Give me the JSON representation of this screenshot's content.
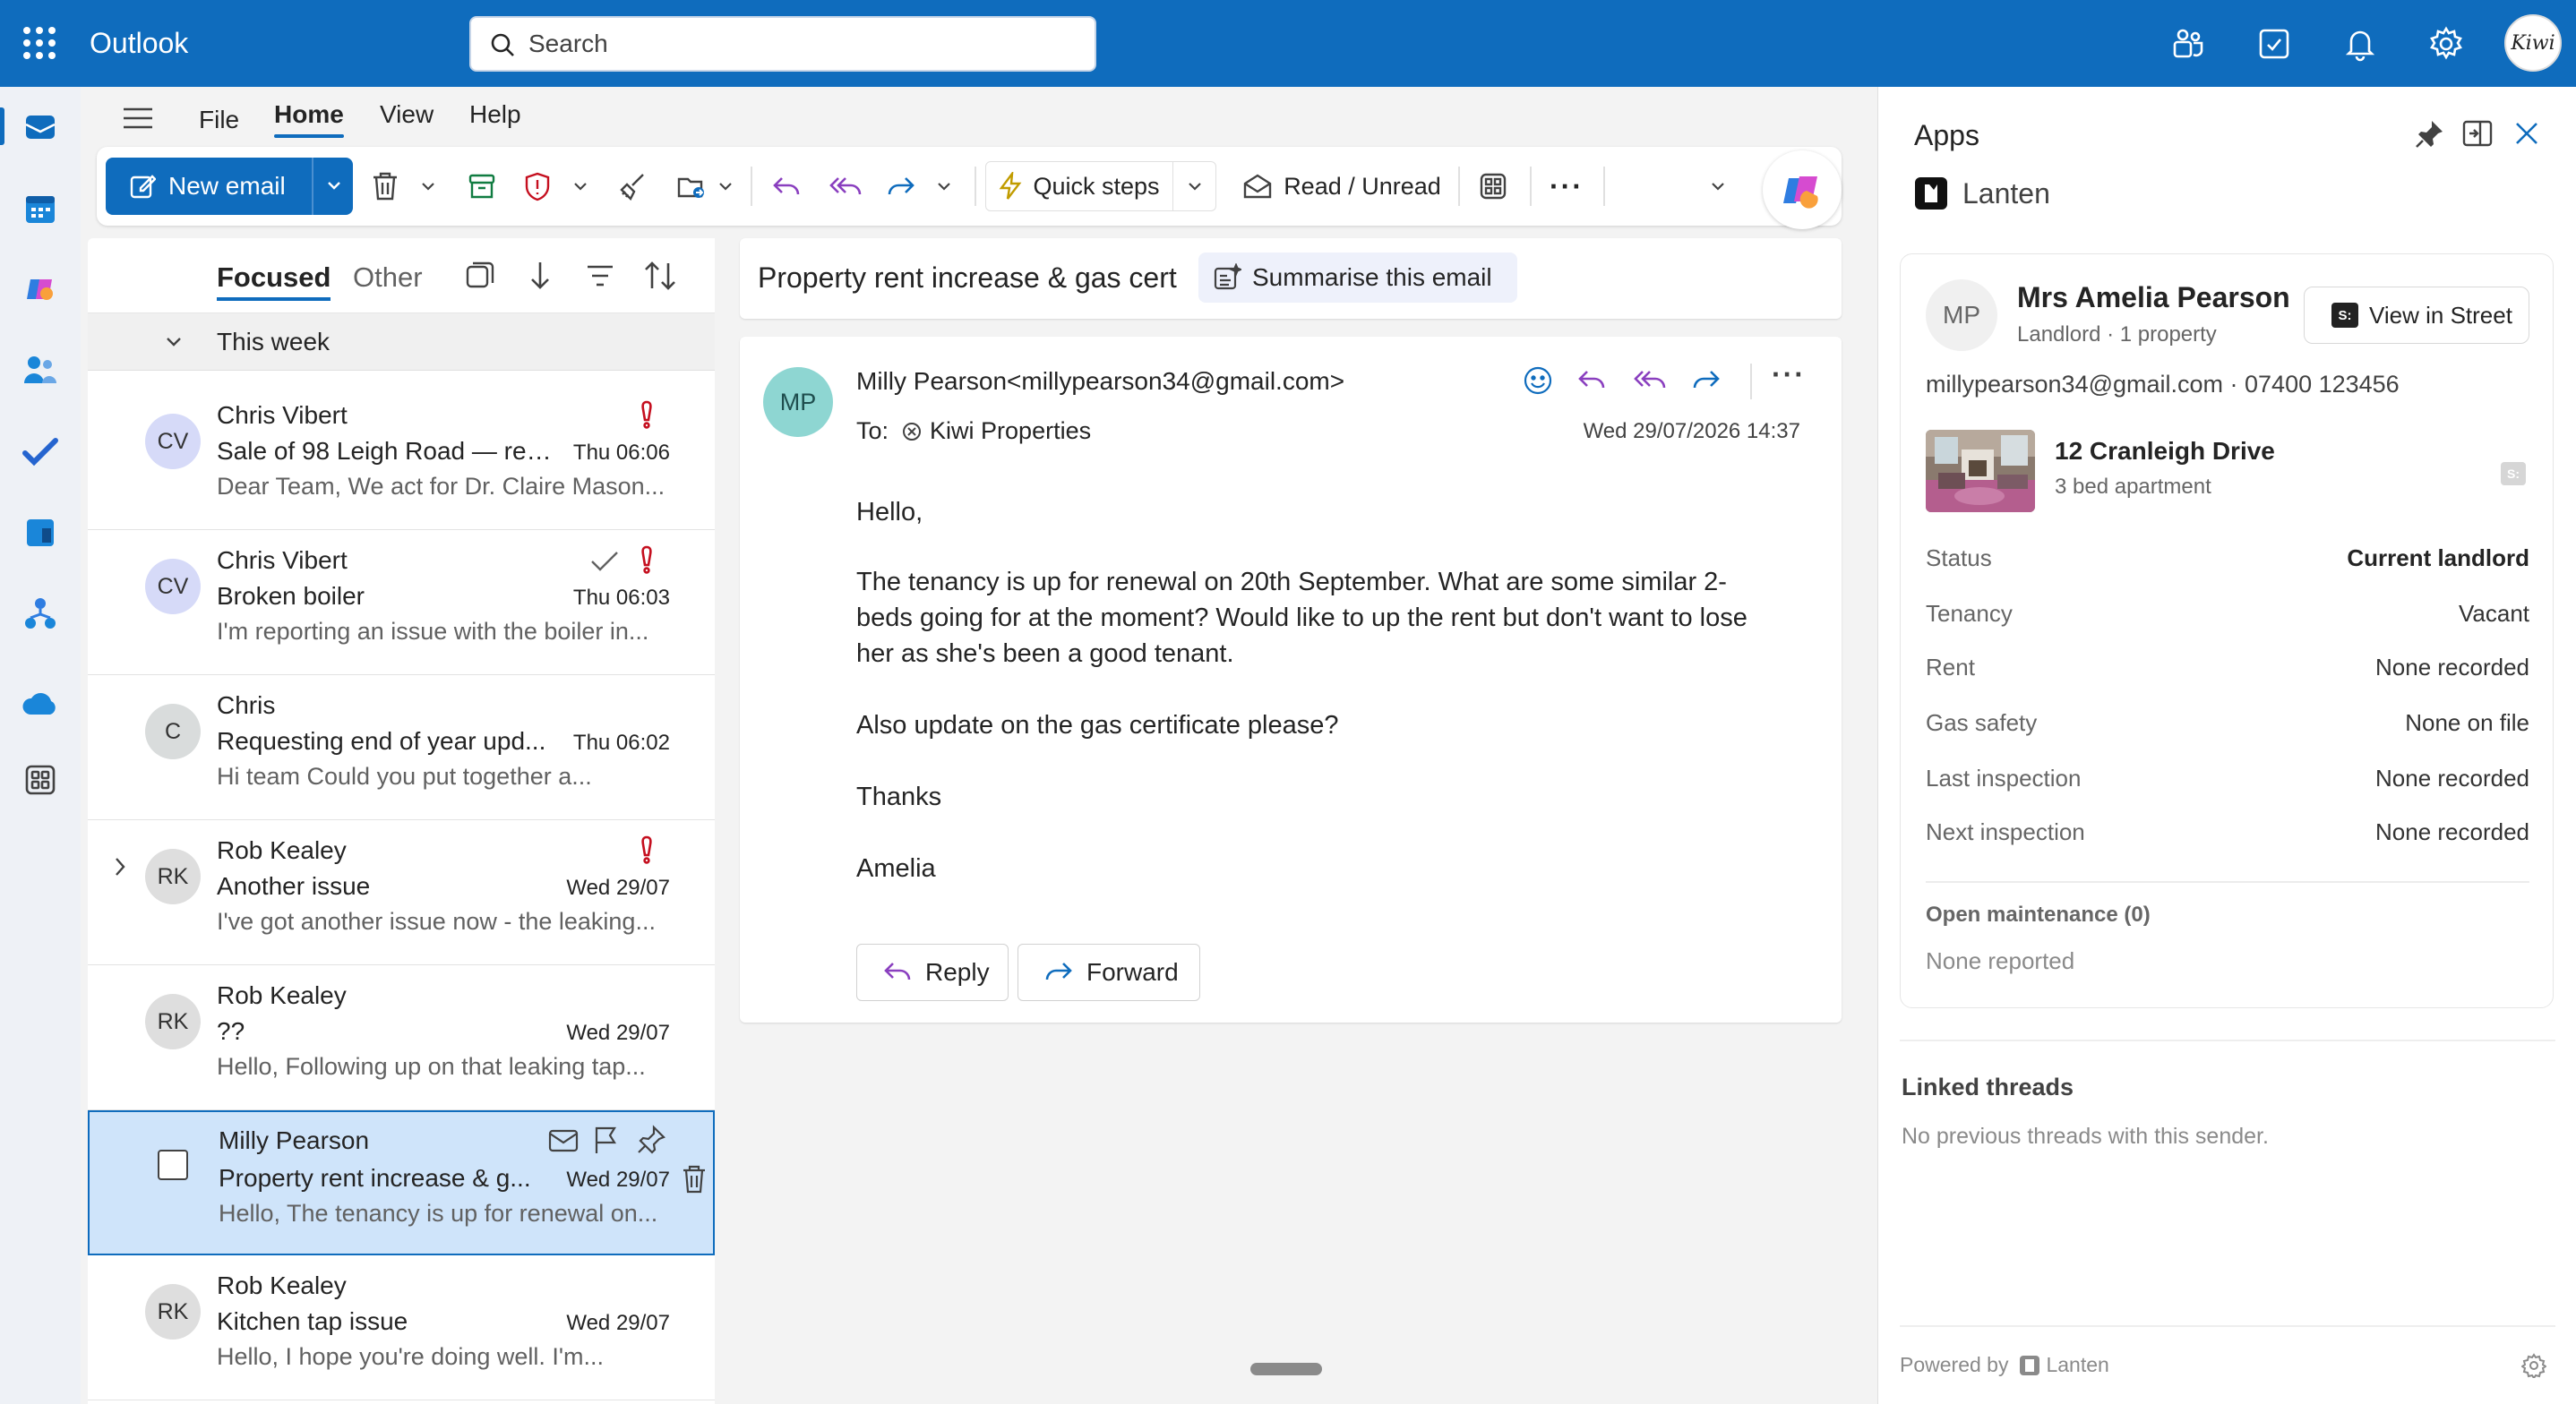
{
  "app": {
    "name": "Outlook"
  },
  "search": {
    "placeholder": "Search"
  },
  "profile": {
    "initials": "Kiwi"
  },
  "menu": {
    "file": "File",
    "home": "Home",
    "view": "View",
    "help": "Help"
  },
  "ribbon": {
    "new_email": "New email",
    "quick_steps": "Quick steps",
    "read_unread": "Read / Unread"
  },
  "list": {
    "tab_focused": "Focused",
    "tab_other": "Other",
    "group": "This week",
    "messages": [
      {
        "initials": "CV",
        "sender": "Chris Vibert",
        "subject": "Sale of 98 Leigh Road — req...",
        "date": "Thu 06:06",
        "preview": "Dear Team, We act for Dr. Claire Mason..."
      },
      {
        "initials": "CV",
        "sender": "Chris Vibert",
        "subject": "Broken boiler",
        "date": "Thu 06:03",
        "preview": "I'm reporting an issue with the boiler in..."
      },
      {
        "initials": "C",
        "sender": "Chris",
        "subject": "Requesting end of year upd...",
        "date": "Thu 06:02",
        "preview": "Hi team Could you put together a..."
      },
      {
        "initials": "RK",
        "sender": "Rob Kealey",
        "subject": "Another issue",
        "date": "Wed 29/07",
        "preview": "I've got another issue now - the leaking..."
      },
      {
        "initials": "RK",
        "sender": "Rob Kealey",
        "subject": "??",
        "date": "Wed 29/07",
        "preview": "Hello, Following up on that leaking tap..."
      },
      {
        "initials": "",
        "sender": "Milly Pearson",
        "subject": "Property rent increase & g...",
        "date": "Wed 29/07",
        "preview": "Hello, The tenancy is up for renewal on..."
      },
      {
        "initials": "RK",
        "sender": "Rob Kealey",
        "subject": "Kitchen tap issue",
        "date": "Wed 29/07",
        "preview": "Hello, I hope you're doing well. I'm..."
      }
    ]
  },
  "reading": {
    "subject": "Property rent increase & gas cert",
    "summarise": "Summarise this email",
    "avatar": "MP",
    "from": "Milly Pearson<millypearson34@gmail.com>",
    "to_label": "To:",
    "to": "Kiwi Properties",
    "date": "Wed 29/07/2026 14:37",
    "body": [
      "Hello,",
      "The tenancy is up for renewal on 20th September. What are some similar 2-beds going for at the moment? Would like to up the rent but don't want to lose her as she's been a good tenant.",
      "Also update on the gas certificate please?",
      "Thanks",
      "Amelia"
    ],
    "reply": "Reply",
    "forward": "Forward"
  },
  "apps": {
    "title": "Apps",
    "app_name": "Lanten",
    "contact": {
      "initials": "MP",
      "name": "Mrs Amelia Pearson",
      "role": "Landlord · 1 property",
      "view_button": "View in Street",
      "view_badge": "S:",
      "details": "millypearson34@gmail.com · 07400 123456"
    },
    "property": {
      "name": "12 Cranleigh Drive",
      "type": "3 bed apartment",
      "badge": "S:"
    },
    "fields": [
      {
        "label": "Status",
        "value": "Current landlord"
      },
      {
        "label": "Tenancy",
        "value": "Vacant"
      },
      {
        "label": "Rent",
        "value": "None recorded"
      },
      {
        "label": "Gas safety",
        "value": "None on file"
      },
      {
        "label": "Last inspection",
        "value": "None recorded"
      },
      {
        "label": "Next inspection",
        "value": "None recorded"
      }
    ],
    "maintenance_title": "Open maintenance (0)",
    "maintenance_empty": "None reported",
    "linked_title": "Linked threads",
    "linked_empty": "No previous threads with this sender.",
    "powered_by": "Powered by",
    "powered_brand": "Lanten"
  },
  "colors": {
    "accent": "#0f6cbd",
    "selected_row": "#cfe4fa",
    "flag": "#c50f1f",
    "reply_purple": "#8a3fbf"
  }
}
